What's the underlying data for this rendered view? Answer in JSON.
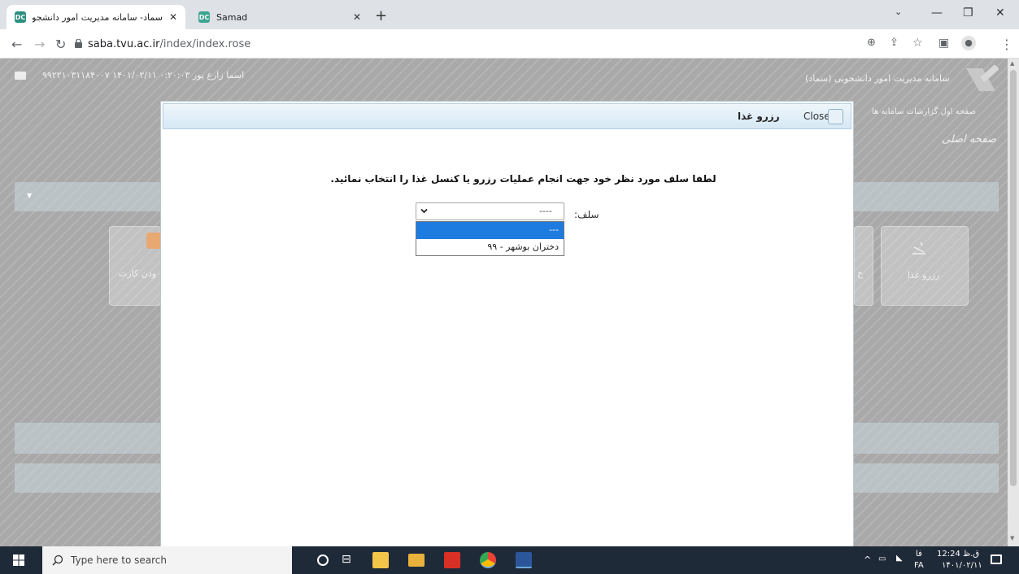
{
  "browser": {
    "tabs": [
      {
        "title": "سماد- سامانه مدیریت امور دانشجو",
        "active": true
      },
      {
        "title": "Samad",
        "active": false
      }
    ],
    "new_tab": "+",
    "url_host": "saba.tvu.ac.ir",
    "url_path": "/index/index.rose"
  },
  "page": {
    "app_title": "سامانه مدیریت امور دانشجویی (سماد)",
    "user_info": "اسما زارع پور  ۰:۲۰:۰۳  ۱۴۰۱/۰۲/۱۱  ۹۹۲۲۱۰۳۱۱۸۴۰۰۷",
    "breadcrumb": "صفحه اول    گزارشات سامانه ها",
    "page_heading": "صفحه اصلی",
    "card_left": "ودن کارت",
    "card_right": "رزرو غذا",
    "card_right_partial": "خ"
  },
  "modal": {
    "title": "رزرو غذا",
    "close_label": "Close",
    "message": "لطفا سلف مورد نظر خود جهت انجام عملیات رزرو یا کنسل غذا را انتخاب نمائید.",
    "field_label": "سلف:",
    "selected_value": "----",
    "options": [
      "---",
      "دختران بوشهر - ۹۹"
    ]
  },
  "taskbar": {
    "search_placeholder": "Type here to search",
    "time": "12:24 ق.ظ",
    "date": "۱۴۰۱/۰۲/۱۱",
    "lang_top": "فا",
    "lang_bottom": "FA"
  },
  "colors": {
    "dropdown_highlight": "#1e7ce0",
    "taskbar": "#1f2a38"
  }
}
